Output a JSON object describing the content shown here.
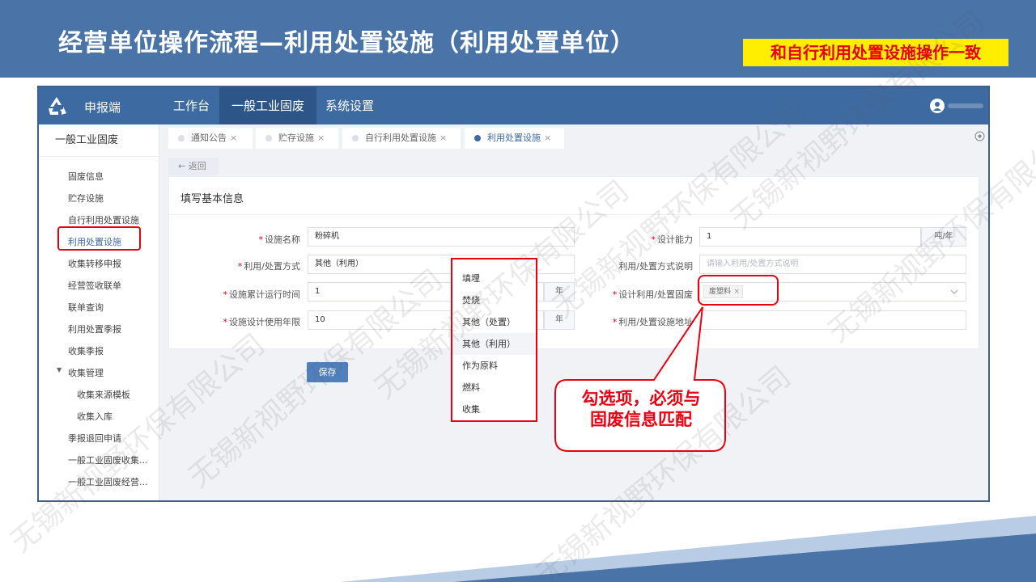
{
  "slide": {
    "title": "经营单位操作流程—利用处置设施（利用处置单位）",
    "highlight_note": "和自行利用处置设施操作一致",
    "callout_line1": "勾选项，必须与",
    "callout_line2": "固废信息匹配",
    "watermark": "无锡新视野环保有限公司",
    "colors": {
      "header": "#4a73a8",
      "accent_red": "#e60012",
      "highlight_bg": "#ffee00"
    }
  },
  "topbar": {
    "logo_icon": "recycle-icon",
    "brand": "申报端",
    "nav": [
      "工作台",
      "一般工业固废",
      "系统设置"
    ],
    "active_nav": "一般工业固废",
    "user_icon": "user-icon"
  },
  "sidebar": {
    "heading": "一般工业固废",
    "items": [
      "固废信息",
      "贮存设施",
      "自行利用处置设施",
      "利用处置设施",
      "收集转移申报",
      "经营签收联单",
      "联单查询",
      "利用处置季报",
      "收集季报"
    ],
    "group": {
      "label": "收集管理",
      "children": [
        "收集来源模板",
        "收集入库"
      ]
    },
    "items_after": [
      "季报退回申请",
      "一般工业固废收集...",
      "一般工业固废经营..."
    ],
    "active_item": "利用处置设施"
  },
  "tabs": [
    {
      "label": "通知公告",
      "active": false
    },
    {
      "label": "贮存设施",
      "active": false
    },
    {
      "label": "自行利用处置设施",
      "active": false
    },
    {
      "label": "利用处置设施",
      "active": true
    }
  ],
  "form": {
    "back_label": "← 返回",
    "section_title": "填写基本信息",
    "left": [
      {
        "label": "设施名称",
        "value": "粉碎机",
        "suffix": ""
      },
      {
        "label": "利用/处置方式",
        "value": "其他（利用）",
        "suffix": ""
      },
      {
        "label": "设施累计运行时间",
        "value": "1",
        "suffix": "年"
      },
      {
        "label": "设施设计使用年限",
        "value": "10",
        "suffix": "年"
      }
    ],
    "right": {
      "capacity_label": "设计能力",
      "capacity_value": "1",
      "capacity_unit": "吨/年",
      "method_desc_label": "利用/处置方式说明",
      "method_desc_placeholder": "请输入利用/处置方式说明",
      "waste_label": "设计利用/处置固废",
      "waste_tag": "废塑料",
      "address_label": "利用/处置设施地址"
    },
    "save_label": "保存"
  },
  "dropdown": {
    "options": [
      "填埋",
      "焚烧",
      "其他（处置）",
      "其他（利用）",
      "作为原料",
      "燃料",
      "收集"
    ],
    "highlighted": "其他（利用）"
  }
}
